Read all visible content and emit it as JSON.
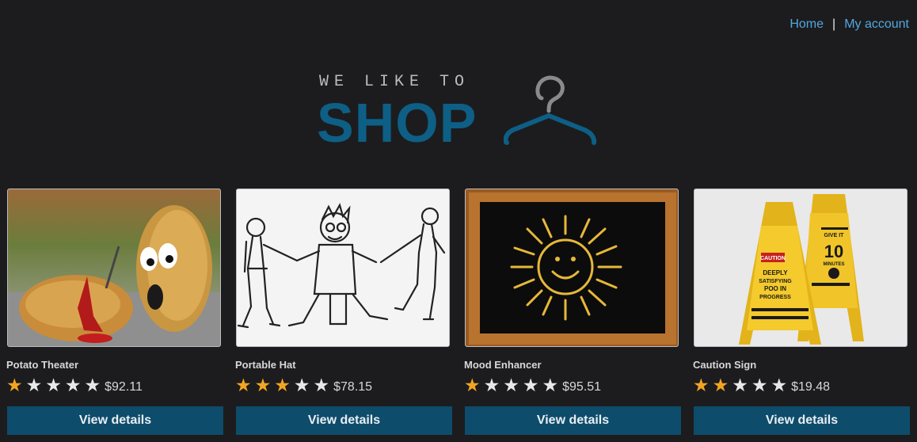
{
  "nav": {
    "home": "Home",
    "separator": "|",
    "account": "My account"
  },
  "logo": {
    "tagline": "WE LIKE TO",
    "word": "SHOP",
    "icon": "hanger-icon",
    "color": "#0d5f86"
  },
  "colors": {
    "link": "#52a7e0",
    "button": "#0e4c6b",
    "star_on": "#f3a522",
    "star_off": "#e8e8e8"
  },
  "products": [
    {
      "name": "Potato Theater",
      "rating": 1,
      "max_rating": 5,
      "price": "$92.11",
      "button": "View details"
    },
    {
      "name": "Portable Hat",
      "rating": 3,
      "max_rating": 5,
      "price": "$78.15",
      "button": "View details"
    },
    {
      "name": "Mood Enhancer",
      "rating": 1,
      "max_rating": 5,
      "price": "$95.51",
      "button": "View details"
    },
    {
      "name": "Caution Sign",
      "rating": 2,
      "max_rating": 5,
      "price": "$19.48",
      "button": "View details",
      "image_text": [
        "CAUTION",
        "DEEPLY",
        "SATISFYING",
        "POO IN",
        "PROGRESS",
        "GIVE IT",
        "10",
        "MINUTES"
      ]
    }
  ]
}
